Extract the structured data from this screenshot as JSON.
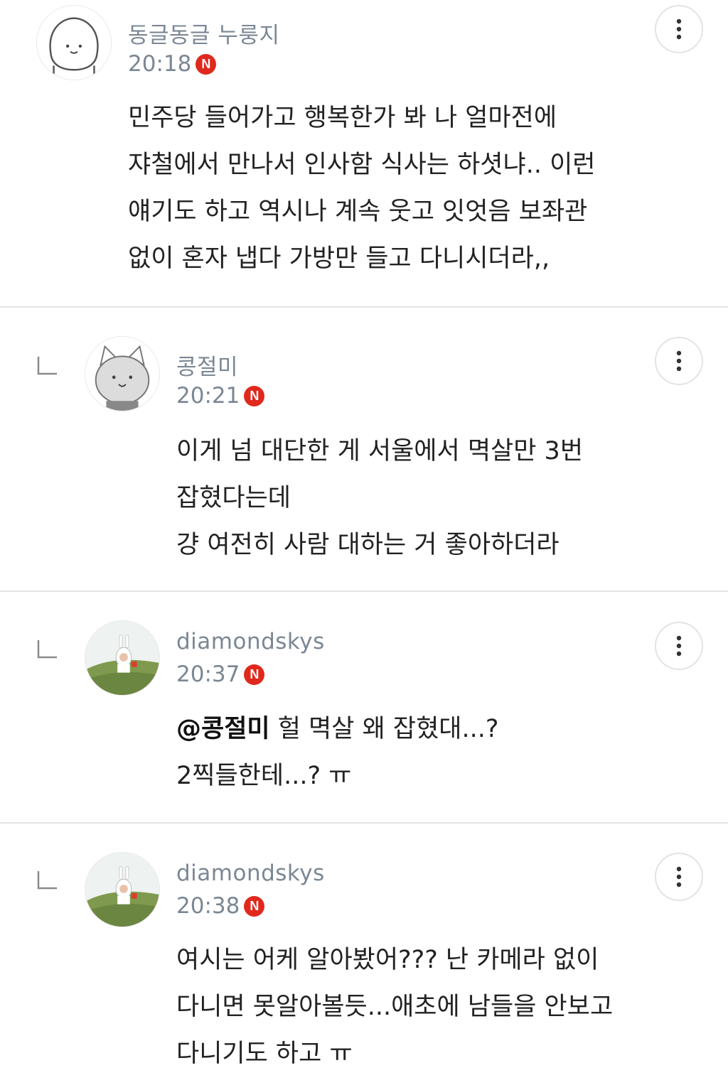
{
  "comments": [
    {
      "author": "동글동글 누룽지",
      "time": "20:18",
      "badge": "N",
      "avatar_icon": "round-character-avatar-icon",
      "lines": [
        "민주당 들어가고 행복한가 봐 나 얼마전에",
        "쟈철에서 만나서 인사함 식사는 하셧냐.. 이런",
        "얘기도 하고 역시나 계속 웃고 잇엇음 보좌관",
        "없이 혼자 냅다 가방만 들고 다니시더라,,"
      ]
    },
    {
      "author": "콩절미",
      "time": "20:21",
      "badge": "N",
      "avatar_icon": "cat-character-avatar-icon",
      "reply_icon": "reply-arrow-icon",
      "lines": [
        "이게 넘 대단한 게 서울에서 멱살만 3번",
        "잡혔다는데",
        "걍 여전히 사람 대하는 거 좋아하더라"
      ]
    },
    {
      "author": "diamondskys",
      "time": "20:37",
      "badge": "N",
      "avatar_icon": "photo-avatar-icon",
      "reply_icon": "reply-arrow-icon",
      "mention": "@콩절미",
      "first_line_rest": " 헐 멱살 왜 잡혔대...?",
      "lines": [
        "2찍들한테...? ㅠ"
      ]
    },
    {
      "author": "diamondskys",
      "time": "20:38",
      "badge": "N",
      "avatar_icon": "photo-avatar-icon",
      "reply_icon": "reply-arrow-icon",
      "lines": [
        "여시는 어케 알아봤어??? 난 카메라 없이",
        "다니면 못알아볼듯...애초에 남들을 안보고",
        "다니기도 하고 ㅠ"
      ]
    }
  ],
  "more_icon": "more-vertical-icon",
  "colors": {
    "meta_text": "#7b8794",
    "body_text": "#222222",
    "badge": "#e0291d",
    "divider": "#e4e4e4"
  }
}
